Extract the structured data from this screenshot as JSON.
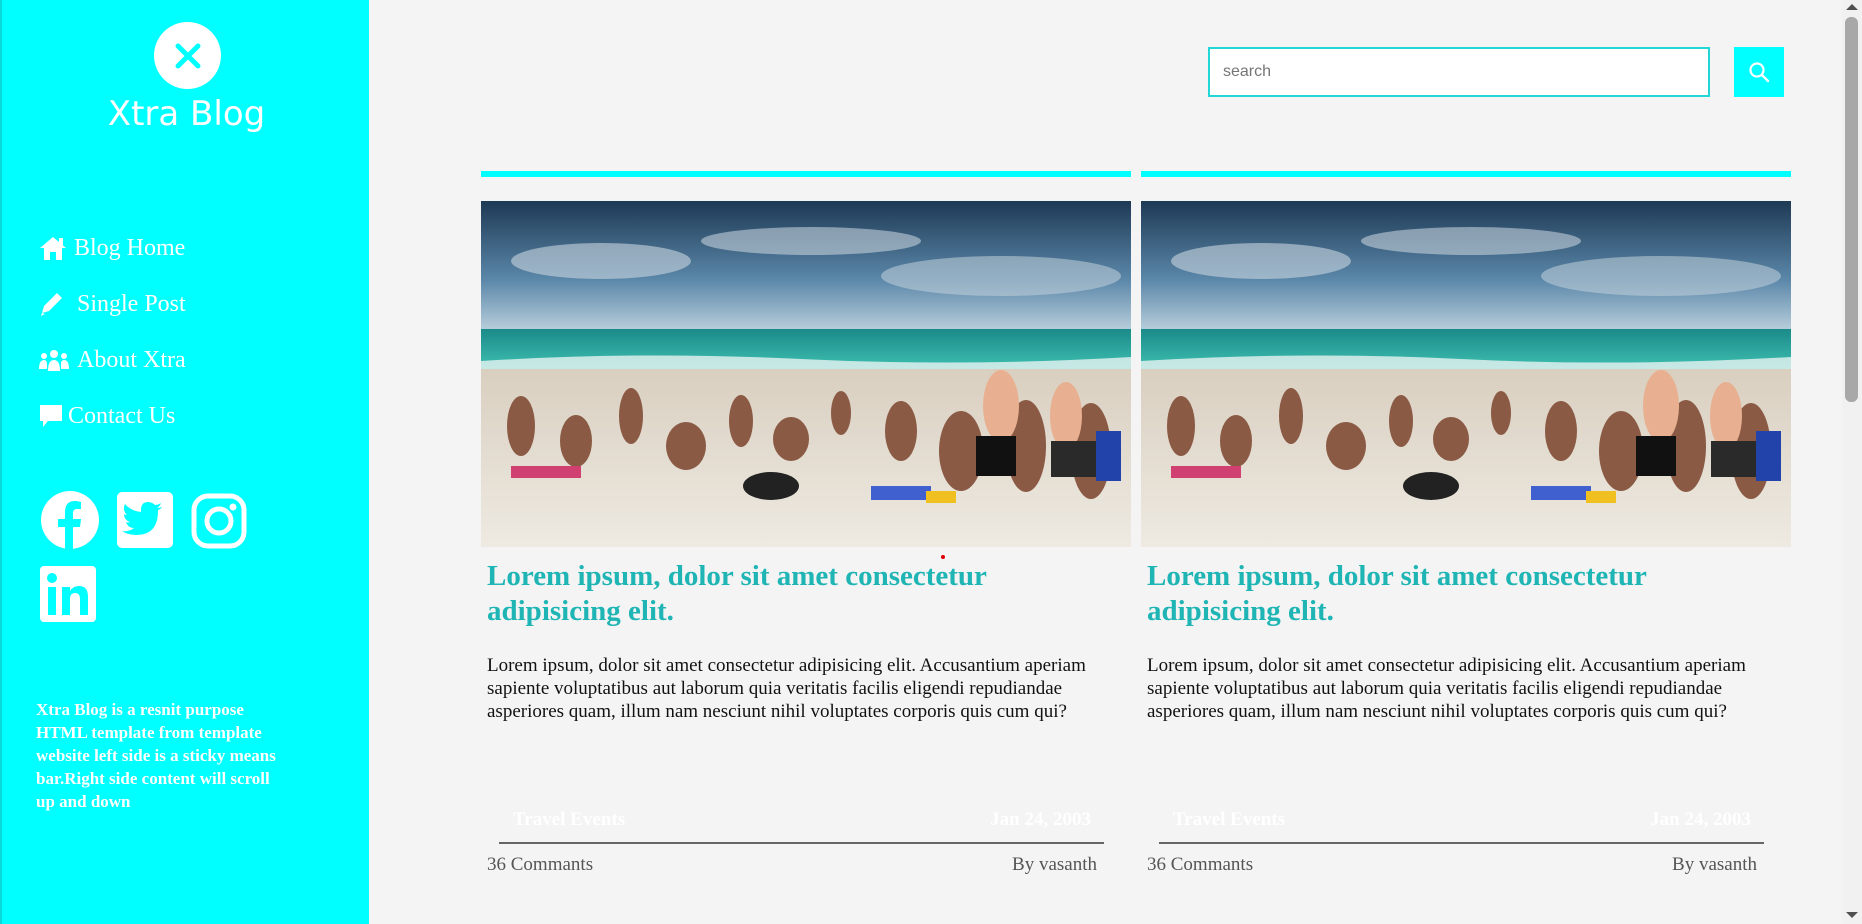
{
  "brand": {
    "title": "Xtra Blog",
    "logo_icon": "x-mark-icon"
  },
  "nav": {
    "items": [
      {
        "label": "Blog Home",
        "icon": "home-icon"
      },
      {
        "label": "Single Post",
        "icon": "pencil-icon"
      },
      {
        "label": "About Xtra",
        "icon": "users-icon"
      },
      {
        "label": "Contact Us",
        "icon": "comment-icon"
      }
    ]
  },
  "social": [
    "facebook-icon",
    "twitter-icon",
    "instagram-icon",
    "linkedin-icon"
  ],
  "about_text": "Xtra Blog is a resnit purpose HTML template from template website left side is a sticky means bar.Right side content will scroll up and down",
  "search": {
    "placeholder": "search",
    "value": ""
  },
  "posts": [
    {
      "title": "Lorem ipsum, dolor sit amet consectetur adipisicing elit.",
      "body": "Lorem ipsum, dolor sit amet consectetur adipisicing elit. Accusantium aperiam sapiente voluptatibus aut laborum quia veritatis facilis eligendi repudiandae asperiores quam, illum nam nesciunt nihil voluptates corporis quis cum qui?",
      "category": "Travel Events",
      "date": "Jan 24, 2003",
      "comments": "36 Commants",
      "author": "By vasanth"
    },
    {
      "title": "Lorem ipsum, dolor sit amet consectetur adipisicing elit.",
      "body": "Lorem ipsum, dolor sit amet consectetur adipisicing elit. Accusantium aperiam sapiente voluptatibus aut laborum quia veritatis facilis eligendi repudiandae asperiores quam, illum nam nesciunt nihil voluptates corporis quis cum qui?",
      "category": "Travel Events",
      "date": "Jan 24, 2003",
      "comments": "36 Commants",
      "author": "By vasanth"
    }
  ],
  "colors": {
    "accent": "#00ffff",
    "title": "#20b5b5",
    "background": "#f4f4f4"
  }
}
